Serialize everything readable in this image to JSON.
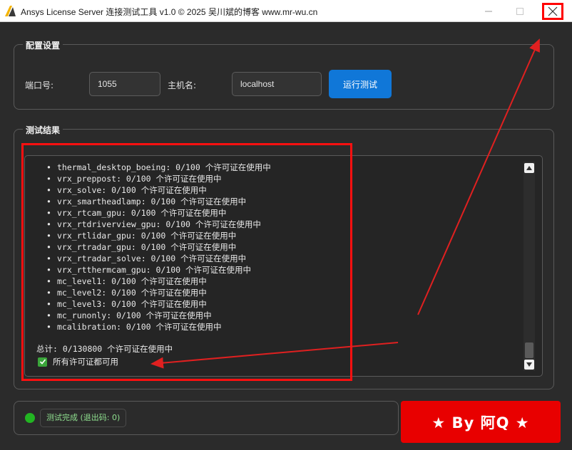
{
  "window": {
    "title": "Ansys License Server 连接测试工具 v1.0 © 2025 吴川斌的博客 www.mr-wu.cn",
    "icons": {
      "app": "ansys-logo-icon",
      "minimize": "minimize-icon",
      "maximize": "maximize-icon",
      "close": "close-icon"
    }
  },
  "config": {
    "title": "配置设置",
    "port_label": "端口号:",
    "port_value": "1055",
    "host_label": "主机名:",
    "host_value": "localhost",
    "run_label": "运行测试"
  },
  "results": {
    "title": "测试结果",
    "bullet": "•",
    "lines": [
      "thermal_desktop_boeing: 0/100 个许可证在使用中",
      "vrx_preppost: 0/100 个许可证在使用中",
      "vrx_solve: 0/100 个许可证在使用中",
      "vrx_smartheadlamp: 0/100 个许可证在使用中",
      "vrx_rtcam_gpu: 0/100 个许可证在使用中",
      "vrx_rtdriverview_gpu: 0/100 个许可证在使用中",
      "vrx_rtlidar_gpu: 0/100 个许可证在使用中",
      "vrx_rtradar_gpu: 0/100 个许可证在使用中",
      "vrx_rtradar_solve: 0/100 个许可证在使用中",
      "vrx_rtthermcam_gpu: 0/100 个许可证在使用中",
      "mc_level1: 0/100 个许可证在使用中",
      "mc_level2: 0/100 个许可证在使用中",
      "mc_level3: 0/100 个许可证在使用中",
      "mc_runonly: 0/100 个许可证在使用中",
      "mcalibration: 0/100 个许可证在使用中"
    ],
    "total": "总计: 0/130800 个许可证在使用中",
    "ok_message": "所有许可证都可用",
    "ok_icon": "checkmark-icon"
  },
  "status": {
    "text": "测试完成 (退出码: 0)",
    "dot_color": "#22b522"
  },
  "banner": {
    "text": "★ By 阿Q ★"
  },
  "colors": {
    "accent": "#1077d8",
    "highlight": "#ff1010"
  }
}
